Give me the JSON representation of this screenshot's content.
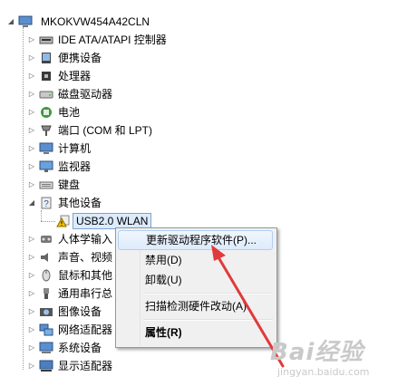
{
  "tree": {
    "root": {
      "label": "MKOKVW454A42CLN",
      "icon": "computer-icon"
    },
    "items": [
      {
        "label": "IDE ATA/ATAPI 控制器",
        "icon": "ide-controller-icon"
      },
      {
        "label": "便携设备",
        "icon": "portable-device-icon"
      },
      {
        "label": "处理器",
        "icon": "processor-icon"
      },
      {
        "label": "磁盘驱动器",
        "icon": "disk-drive-icon"
      },
      {
        "label": "电池",
        "icon": "battery-icon"
      },
      {
        "label": "端口 (COM 和 LPT)",
        "icon": "port-icon"
      },
      {
        "label": "计算机",
        "icon": "computer-icon"
      },
      {
        "label": "监视器",
        "icon": "monitor-icon"
      },
      {
        "label": "键盘",
        "icon": "keyboard-icon"
      },
      {
        "label": "其他设备",
        "icon": "other-devices-icon",
        "expanded": true
      },
      {
        "label": "USB2.0 WLAN",
        "icon": "warning-device-icon",
        "child": true,
        "selected": true
      },
      {
        "label": "人体学输入",
        "icon": "hid-icon"
      },
      {
        "label": "声音、视频",
        "icon": "sound-icon"
      },
      {
        "label": "鼠标和其他",
        "icon": "mouse-icon"
      },
      {
        "label": "通用串行总",
        "icon": "usb-icon"
      },
      {
        "label": "图像设备",
        "icon": "imaging-device-icon"
      },
      {
        "label": "网络适配器",
        "icon": "network-adapter-icon"
      },
      {
        "label": "系统设备",
        "icon": "system-device-icon"
      },
      {
        "label": "显示适配器",
        "icon": "display-adapter-icon"
      }
    ]
  },
  "context_menu": {
    "items": [
      {
        "label": "更新驱动程序软件(P)...",
        "highlighted": true
      },
      {
        "label": "禁用(D)"
      },
      {
        "label": "卸载(U)"
      },
      {
        "label": "扫描检测硬件改动(A)"
      },
      {
        "label": "属性(R)",
        "bold": true
      }
    ]
  },
  "watermark": {
    "main": "Bai经验",
    "sub": "jingyan.baidu.com"
  },
  "colors": {
    "arrow": "#e03a3a",
    "selection": "#dcebfc",
    "menu_bg": "#f0f0f0"
  }
}
